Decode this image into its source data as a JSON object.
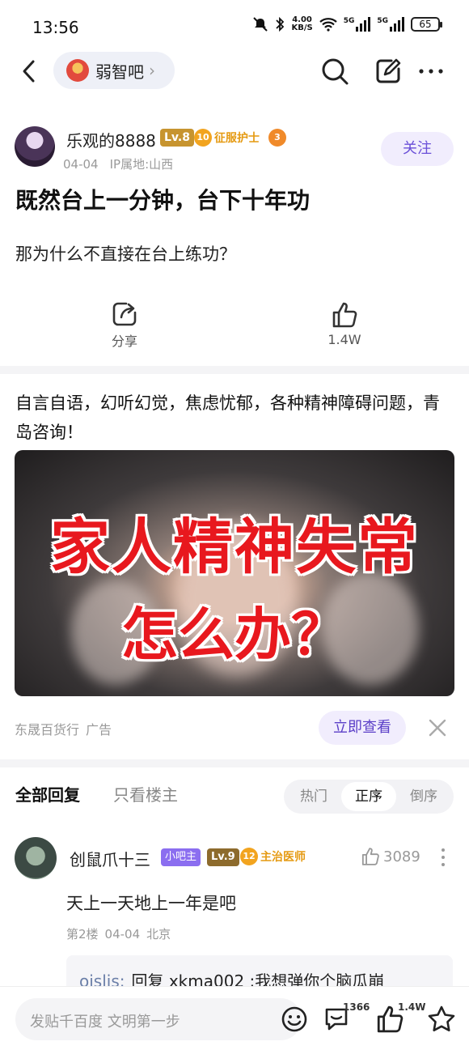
{
  "status": {
    "time": "13:56",
    "speed_top": "4.00",
    "speed_unit": "KB/S",
    "net1": "5G",
    "net2": "5G",
    "battery": "65"
  },
  "nav": {
    "forum_name": "弱智吧"
  },
  "post": {
    "author": "乐观的8888",
    "level": "Lv.8",
    "medal_level": "10",
    "medal_title": "征服护士",
    "badge3": "3",
    "date": "04-04",
    "ip": "IP属地:山西",
    "follow_label": "关注",
    "title": "既然台上一分钟，台下十年功",
    "body": "那为什么不直接在台上练功？",
    "share_label": "分享",
    "like_count": "1.4W"
  },
  "ad": {
    "text": "自言自语，幻听幻觉，焦虑忧郁，各种精神障碍问题，青岛咨询！",
    "headline": "家人精神失常",
    "subheadline": "怎么办？",
    "advertiser": "东晟百货行",
    "ad_tag": "广告",
    "cta": "立即查看"
  },
  "replies_header": {
    "all_label": "全部回复",
    "op_only_label": "只看楼主",
    "sort": [
      "热门",
      "正序",
      "倒序"
    ],
    "sort_active_index": 1
  },
  "reply": {
    "name": "创鼠爪十三",
    "owner_badge": "小吧主",
    "level": "Lv.9",
    "medal_level": "12",
    "medal_title": "主治医师",
    "likes": "3089",
    "text": "天上一天地上一年是吧",
    "floor": "第2楼",
    "date": "04-04",
    "location": "北京",
    "sub_author": "oislis:",
    "sub_text": "回复 xkma002 :我想弹你个脑瓜崩"
  },
  "bottom": {
    "input_placeholder": "发贴千百度 文明第一步",
    "comment_count": "1366",
    "like_count": "1.4W"
  },
  "colors": {
    "accent": "#6a4fd8",
    "ad_red": "#e8181e",
    "gold": "#f2a41f"
  }
}
